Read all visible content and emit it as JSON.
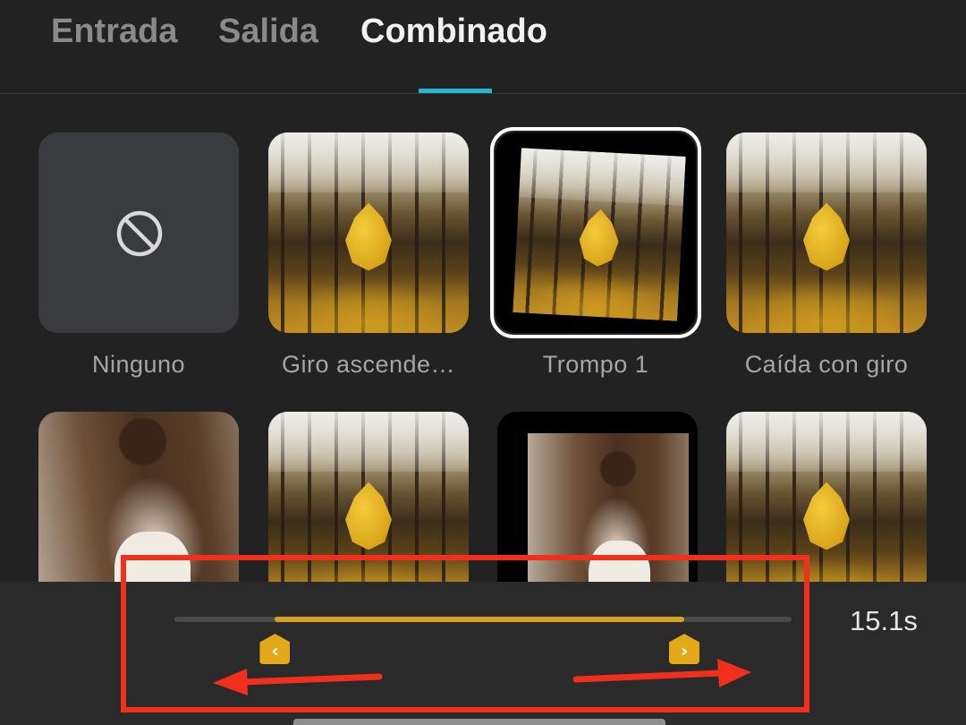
{
  "tabs": [
    {
      "label": "Entrada",
      "active": false
    },
    {
      "label": "Salida",
      "active": false
    },
    {
      "label": "Combinado",
      "active": true
    }
  ],
  "animations": [
    {
      "label": "Ninguno",
      "icon": "no-entry-icon"
    },
    {
      "label": "Giro ascende…"
    },
    {
      "label": "Trompo 1",
      "selected": true
    },
    {
      "label": "Caída con giro"
    }
  ],
  "timeline": {
    "duration": "15.1s",
    "range_start_fraction": 0.163,
    "range_end_fraction": 0.826,
    "start_handle_icon": "chevron-left-icon",
    "end_handle_icon": "chevron-right-icon"
  },
  "colors": {
    "accent_tab": "#22b8d1",
    "range_fill": "#d8a21a",
    "annotation": "#f0301c"
  }
}
